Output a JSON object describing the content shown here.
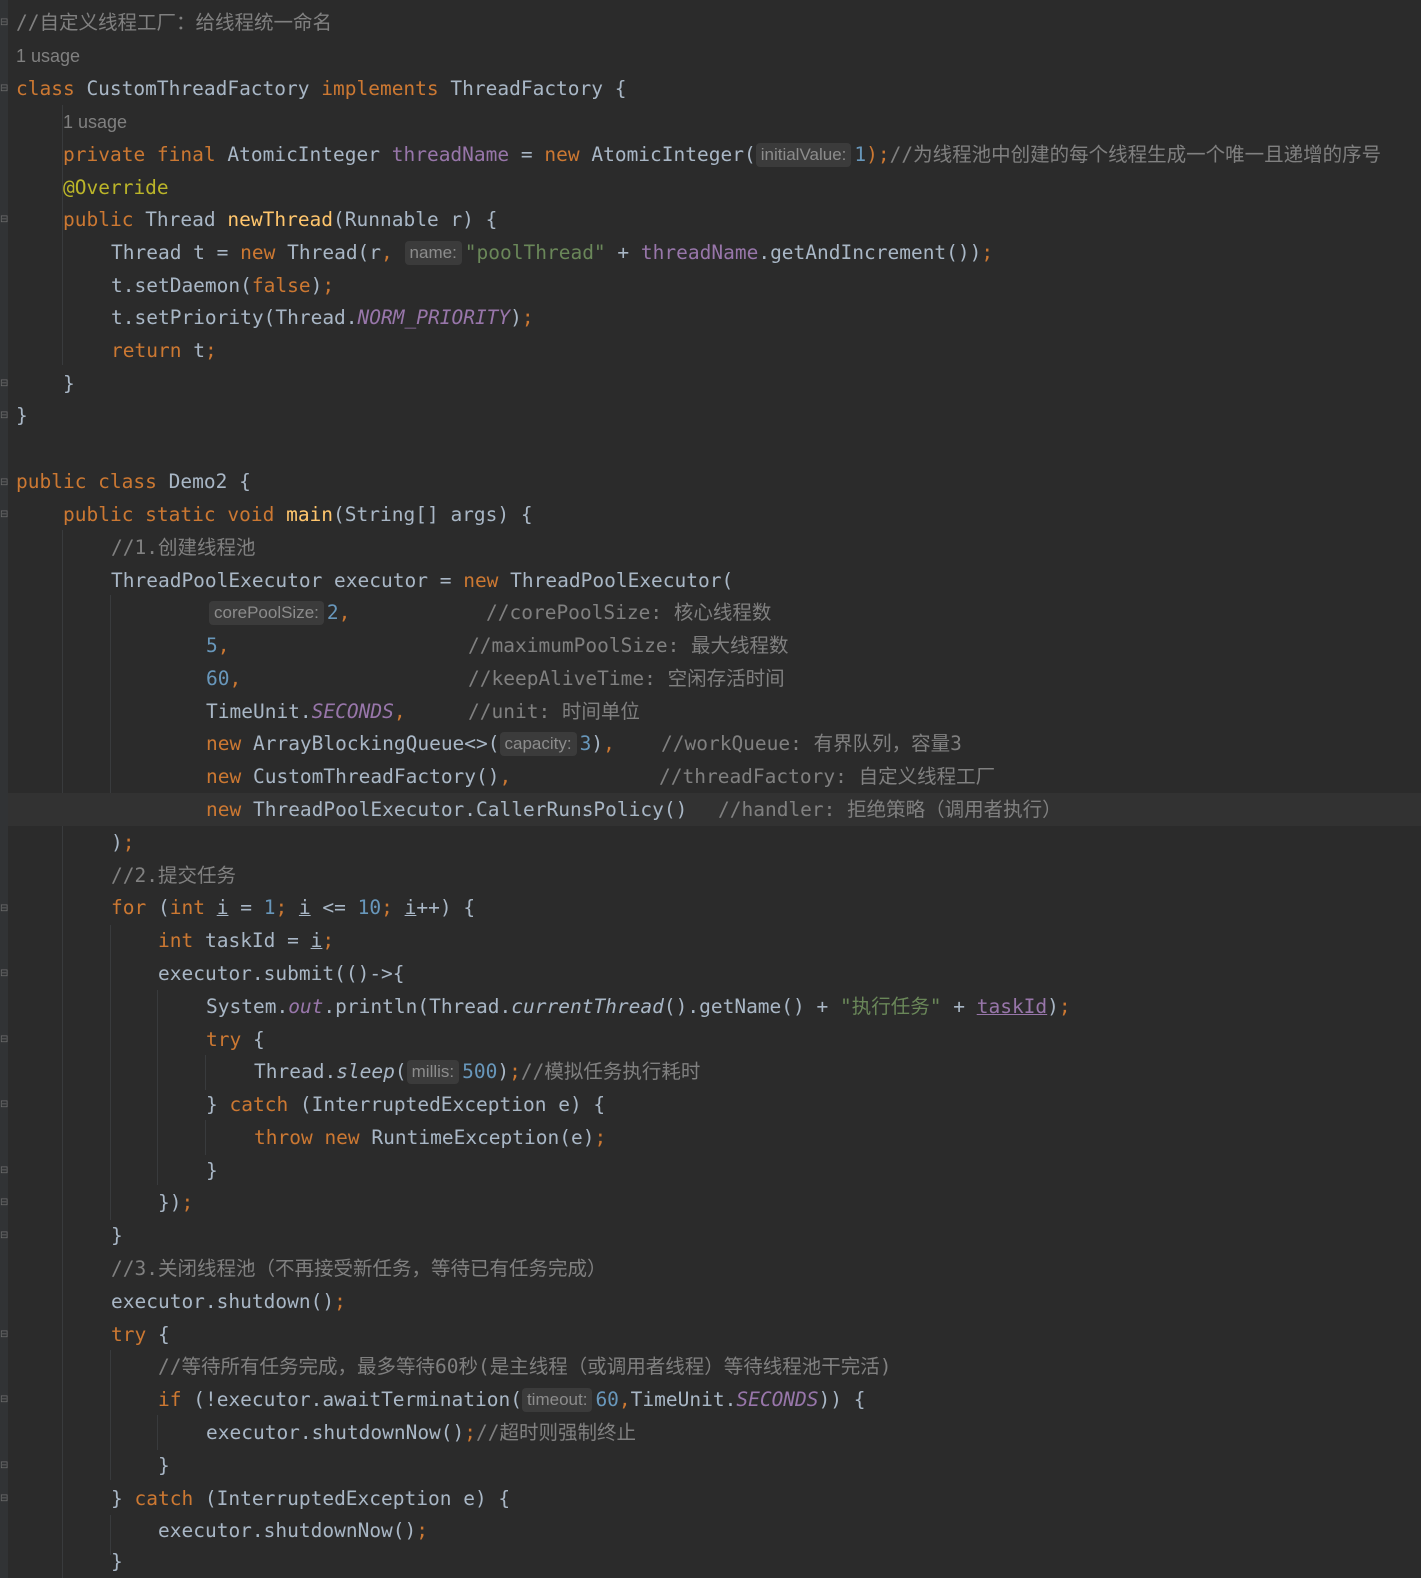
{
  "editor": {
    "language": "Java",
    "theme": "Darcula",
    "usage_1": "1 usage",
    "usage_2": "1 usage",
    "lines": {
      "l01": "//自定义线程工厂：给线程统一命名",
      "l03a": "class",
      "l03b": " CustomThreadFactory ",
      "l03c": "implements",
      "l03d": " ThreadFactory {",
      "l05a": "private final",
      "l05b": " AtomicInteger ",
      "l05c": "threadName",
      "l05d": " = ",
      "l05e": "new",
      "l05f": " AtomicInteger(",
      "l05hint": "initialValue:",
      "l05g": "1",
      "l05h": ");",
      "l05i": "//为线程池中创建的每个线程生成一个唯一且递增的序号",
      "l06": "@Override",
      "l07a": "public",
      "l07b": " Thread ",
      "l07c": "newThread",
      "l07d": "(Runnable r) {",
      "l08a": "Thread t = ",
      "l08b": "new",
      "l08c": " Thread(r",
      "l08d": ",",
      "l08hint": "name:",
      "l08e": "\"poolThread\"",
      "l08f": " + ",
      "l08g": "threadName",
      "l08h": ".getAndIncrement())",
      "l08i": ";",
      "l09a": "t.setDaemon(",
      "l09b": "false",
      "l09c": ")",
      "l09d": ";",
      "l10a": "t.setPriority(Thread.",
      "l10b": "NORM_PRIORITY",
      "l10c": ")",
      "l10d": ";",
      "l11a": "return",
      "l11b": " t",
      "l11c": ";",
      "l12": "}",
      "l13": "}",
      "l15a": "public class",
      "l15b": " Demo2 {",
      "l16a": "public static void",
      "l16b": " ",
      "l16c": "main",
      "l16d": "(String[] args) {",
      "l17": "//1.创建线程池",
      "l18a": "ThreadPoolExecutor executor = ",
      "l18b": "new",
      "l18c": " ThreadPoolExecutor(",
      "l19hint": "corePoolSize:",
      "l19a": "2",
      "l19b": ",",
      "l19c": "//corePoolSize: 核心线程数",
      "l20a": "5",
      "l20b": ",",
      "l20c": "//maximumPoolSize: 最大线程数",
      "l21a": "60",
      "l21b": ",",
      "l21c": "//keepAliveTime: 空闲存活时间",
      "l22a": "TimeUnit.",
      "l22b": "SECONDS",
      "l22c": ",",
      "l22d": "//unit: 时间单位",
      "l23a": "new",
      "l23b": " ArrayBlockingQueue<>(",
      "l23hint": "capacity:",
      "l23c": "3",
      "l23d": ")",
      "l23e": ",",
      "l23f": "//workQueue: 有界队列，容量3",
      "l24a": "new",
      "l24b": " CustomThreadFactory()",
      "l24c": ",",
      "l24d": "//threadFactory: 自定义线程工厂",
      "l25a": "new",
      "l25b": " ThreadPoolExecutor.CallerRunsPolicy()",
      "l25c": "//handler: 拒绝策略（调用者执行）",
      "l26a": ")",
      "l26b": ";",
      "l27": "//2.提交任务",
      "l28a": "for",
      "l28b": " (",
      "l28c": "int",
      "l28d": " ",
      "l28e": "i",
      "l28f": " = ",
      "l28g": "1",
      "l28h": "; ",
      "l28i": "i",
      "l28j": " <= ",
      "l28k": "10",
      "l28l": "; ",
      "l28m": "i",
      "l28n": "++) {",
      "l29a": "int",
      "l29b": " taskId = ",
      "l29c": "i",
      "l29d": ";",
      "l30": "executor.submit(()->{",
      "l31a": "System.",
      "l31b": "out",
      "l31c": ".println(Thread.",
      "l31d": "currentThread",
      "l31e": "().getName() + ",
      "l31f": "\"执行任务\"",
      "l31g": " + ",
      "l31h": "taskId",
      "l31i": ")",
      "l31j": ";",
      "l32a": "try",
      "l32b": " {",
      "l33a": "Thread.",
      "l33b": "sleep",
      "l33c": "(",
      "l33hint": "millis:",
      "l33d": "500",
      "l33e": ")",
      "l33f": ";",
      "l33g": "//模拟任务执行耗时",
      "l34a": "} ",
      "l34b": "catch",
      "l34c": " (InterruptedException e) {",
      "l35a": "throw new",
      "l35b": " RuntimeException(e)",
      "l35c": ";",
      "l36": "}",
      "l37a": "})",
      "l37b": ";",
      "l38": "}",
      "l39": "//3.关闭线程池（不再接受新任务，等待已有任务完成）",
      "l40a": "executor.shutdown()",
      "l40b": ";",
      "l41a": "try",
      "l41b": " {",
      "l42": "//等待所有任务完成，最多等待60秒(是主线程（或调用者线程）等待线程池干完活)",
      "l43a": "if",
      "l43b": " (!executor.awaitTermination(",
      "l43hint": "timeout:",
      "l43c": "60",
      "l43d": ",",
      "l43e": "TimeUnit.",
      "l43f": "SECONDS",
      "l43g": ")) {",
      "l44a": "executor.shutdownNow()",
      "l44b": ";",
      "l44c": "//超时则强制终止",
      "l45": "}",
      "l46a": "} ",
      "l46b": "catch",
      "l46c": " (InterruptedException e) {",
      "l47a": "executor.shutdownNow()",
      "l47b": ";",
      "l48": "}"
    }
  }
}
